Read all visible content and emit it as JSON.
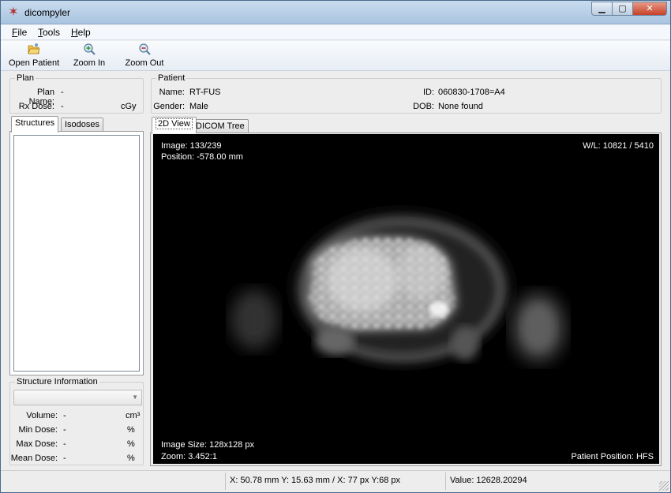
{
  "app": {
    "title": "dicompyler"
  },
  "menu": {
    "file": {
      "key": "F",
      "rest": "ile"
    },
    "tools": {
      "key": "T",
      "rest": "ools"
    },
    "help": {
      "key": "H",
      "rest": "elp"
    }
  },
  "toolbar": {
    "open_patient": "Open Patient",
    "zoom_in": "Zoom In",
    "zoom_out": "Zoom Out"
  },
  "plan": {
    "title": "Plan",
    "plan_name_label": "Plan Name:",
    "plan_name_value": "-",
    "rx_dose_label": "Rx Dose:",
    "rx_dose_value": "-",
    "rx_dose_unit": "cGy"
  },
  "patient": {
    "title": "Patient",
    "name_label": "Name:",
    "name_value": "RT-FUS",
    "gender_label": "Gender:",
    "gender_value": "Male",
    "id_label": "ID:",
    "id_value": "060830-1708=A4",
    "dob_label": "DOB:",
    "dob_value": "None found"
  },
  "left_tabs": {
    "structures": "Structures",
    "isodoses": "Isodoses"
  },
  "structure_info": {
    "title": "Structure Information",
    "rows": [
      {
        "label": "Volume:",
        "value": "-",
        "unit": "cm³"
      },
      {
        "label": "Min Dose:",
        "value": "-",
        "unit": "%"
      },
      {
        "label": "Max Dose:",
        "value": "-",
        "unit": "%"
      },
      {
        "label": "Mean Dose:",
        "value": "-",
        "unit": "%"
      }
    ]
  },
  "view_tabs": {
    "view2d": "2D View",
    "dicom_tree": "DICOM Tree"
  },
  "viewer": {
    "image_index": "Image: 133/239",
    "position": "Position: -578.00 mm",
    "window_level": "W/L: 10821 / 5410",
    "image_size": "Image Size: 128x128 px",
    "zoom": "Zoom: 3.452:1",
    "patient_position": "Patient Position: HFS"
  },
  "status": {
    "coords": "X: 50.78 mm Y: 15.63 mm / X: 77 px Y:68 px",
    "value": "Value: 12628.20294"
  },
  "colors": {
    "titlebar": "#a9c4e0",
    "viewer_bg": "#000000",
    "window_bg": "#ededed"
  },
  "icons": [
    "app-logo-icon",
    "open-folder-icon",
    "zoom-in-icon",
    "zoom-out-icon"
  ]
}
